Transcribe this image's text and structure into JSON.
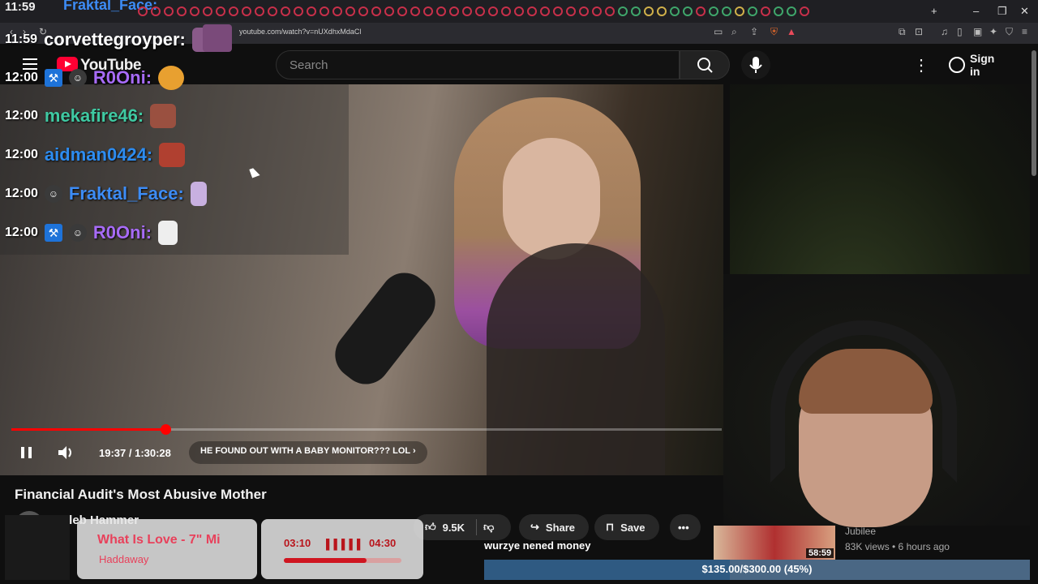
{
  "browser": {
    "top_chat_time": "11:59",
    "top_chat_name": "Fraktal_Face:",
    "url": "youtube.com/watch?v=nUXdhxMdaCl"
  },
  "header": {
    "logo_text": "YouTube",
    "search_placeholder": "Search",
    "sign_in": "Sign in"
  },
  "chat": [
    {
      "time": "11:59",
      "name": "corvettegroyper:",
      "color": "#ffffff",
      "badges": []
    },
    {
      "time": "12:00",
      "name": "R0Oni:",
      "color": "#a76bf7",
      "badges": [
        "hammer-badge",
        "emote-badge"
      ]
    },
    {
      "time": "12:00",
      "name": "mekafire46:",
      "color": "#3fc9a2",
      "badges": []
    },
    {
      "time": "12:00",
      "name": "aidman0424:",
      "color": "#2d8cf0",
      "badges": []
    },
    {
      "time": "12:00",
      "name": "Fraktal_Face:",
      "color": "#3d8cf5",
      "badges": [
        "emote-badge"
      ]
    },
    {
      "time": "12:00",
      "name": "R0Oni:",
      "color": "#a76bf7",
      "badges": [
        "hammer-badge",
        "emote-badge"
      ]
    }
  ],
  "player": {
    "current_time": "19:37",
    "duration": "1:30:28",
    "time_display": "19:37 / 1:30:28",
    "progress": 0.2168,
    "chapter": "HE FOUND OUT WITH A BABY MONITOR??? LOL"
  },
  "video": {
    "title": "Financial Audit's Most Abusive Mother",
    "channel": "Caleb Hammer",
    "likes": "9.5K",
    "share": "Share",
    "save": "Save"
  },
  "music": {
    "song": "What Is Love - 7\" Mi",
    "artist": "Haddaway",
    "elapsed": "03:10",
    "total": "04:30",
    "progress": 0.7037
  },
  "goal": {
    "message": "wurzye nened money",
    "text": "$135.00/$300.00 (45%)",
    "progress": 0.45
  },
  "recommendation": {
    "duration": "58:59",
    "channel": "Jubilee",
    "meta": "83K views • 6 hours ago"
  },
  "colors": {
    "accent": "#ff0000",
    "music_text": "#e8415b",
    "goal_bar": "#4a6784"
  }
}
